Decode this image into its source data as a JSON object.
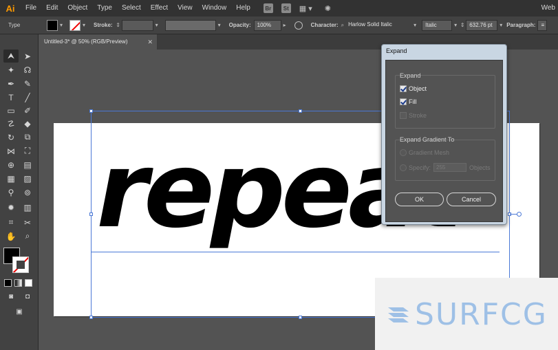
{
  "menubar": {
    "logo": "Ai",
    "items": [
      "File",
      "Edit",
      "Object",
      "Type",
      "Select",
      "Effect",
      "View",
      "Window",
      "Help"
    ],
    "bridge": "Br",
    "stock": "St",
    "arrange_icon": "grid-icon",
    "sync_icon": "gpu-sync-icon",
    "workspace": "Web"
  },
  "controlbar": {
    "selection_type": "Type",
    "fill_color": "#000000",
    "stroke_color": "none",
    "stroke_label": "Stroke:",
    "opacity_label": "Opacity:",
    "opacity_value": "100%",
    "character_label": "Character:",
    "font_family": "Harlow Solid Italic",
    "font_style": "Italic",
    "font_size": "632.76 pt",
    "paragraph_label": "Paragraph:"
  },
  "document": {
    "tab_title": "Untitled-3* @ 50% (RGB/Preview)",
    "artwork_text": "repeat"
  },
  "tools": {
    "icons": [
      "selection-tool-icon",
      "direct-selection-tool-icon",
      "magic-wand-icon",
      "lasso-icon",
      "pen-icon",
      "curvature-icon",
      "type-tool-icon",
      "line-tool-icon",
      "rectangle-tool-icon",
      "paintbrush-icon",
      "shaper-icon",
      "eraser-icon",
      "rotate-icon",
      "scale-icon",
      "width-icon",
      "free-transform-icon",
      "shape-builder-icon",
      "perspective-grid-icon",
      "mesh-icon",
      "gradient-icon",
      "eyedropper-icon",
      "blend-icon",
      "symbol-sprayer-icon",
      "column-graph-icon",
      "artboard-icon",
      "slice-icon",
      "hand-icon",
      "zoom-icon"
    ]
  },
  "dialog": {
    "title": "Expand",
    "expand_group": "Expand",
    "object_label": "Object",
    "object_checked": true,
    "fill_label": "Fill",
    "fill_checked": true,
    "stroke_label": "Stroke",
    "stroke_checked": false,
    "gradient_group": "Expand Gradient To",
    "gradient_mesh_label": "Gradient Mesh",
    "specify_label": "Specify:",
    "specify_value": "255",
    "objects_label": "Objects",
    "ok_label": "OK",
    "cancel_label": "Cancel"
  },
  "watermark": {
    "text": "SURFCG"
  }
}
